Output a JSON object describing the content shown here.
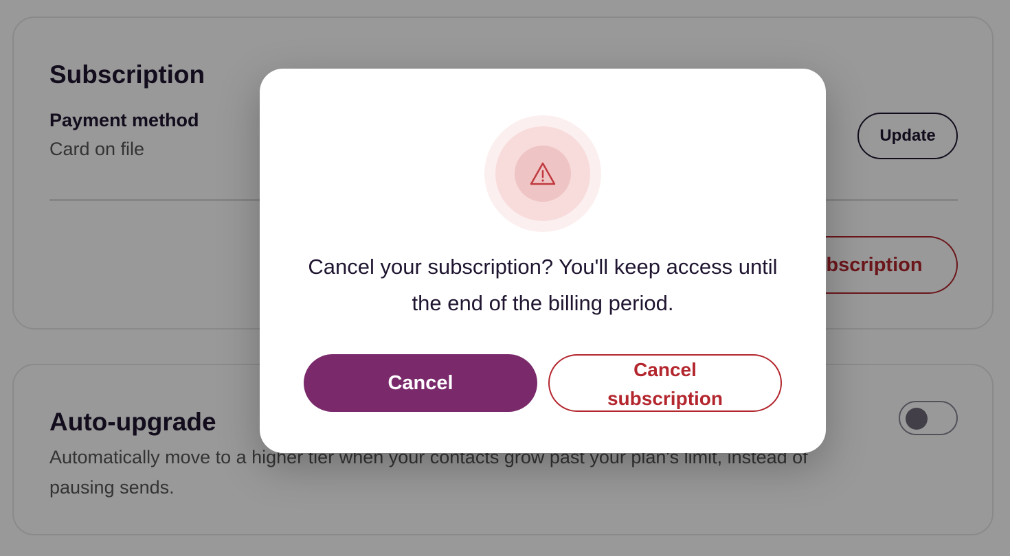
{
  "subscription": {
    "title": "Subscription",
    "payment_method_label": "Payment method",
    "payment_method_value": "Card on file",
    "update_label": "Update",
    "cancel_subscription_label": "Cancel subscription"
  },
  "auto_upgrade": {
    "title": "Auto-upgrade",
    "description": "Automatically move to a higher tier when your contacts grow past your plan's limit, instead of pausing sends.",
    "toggle_on": false
  },
  "modal": {
    "icon": "warning-triangle-icon",
    "message": "Cancel your subscription? You'll keep access until the end of the billing period.",
    "cancel_label": "Cancel",
    "confirm_label": "Cancel subscription"
  },
  "colors": {
    "primary": "#7a2a6b",
    "danger": "#b3262e",
    "text": "#1f1530"
  }
}
